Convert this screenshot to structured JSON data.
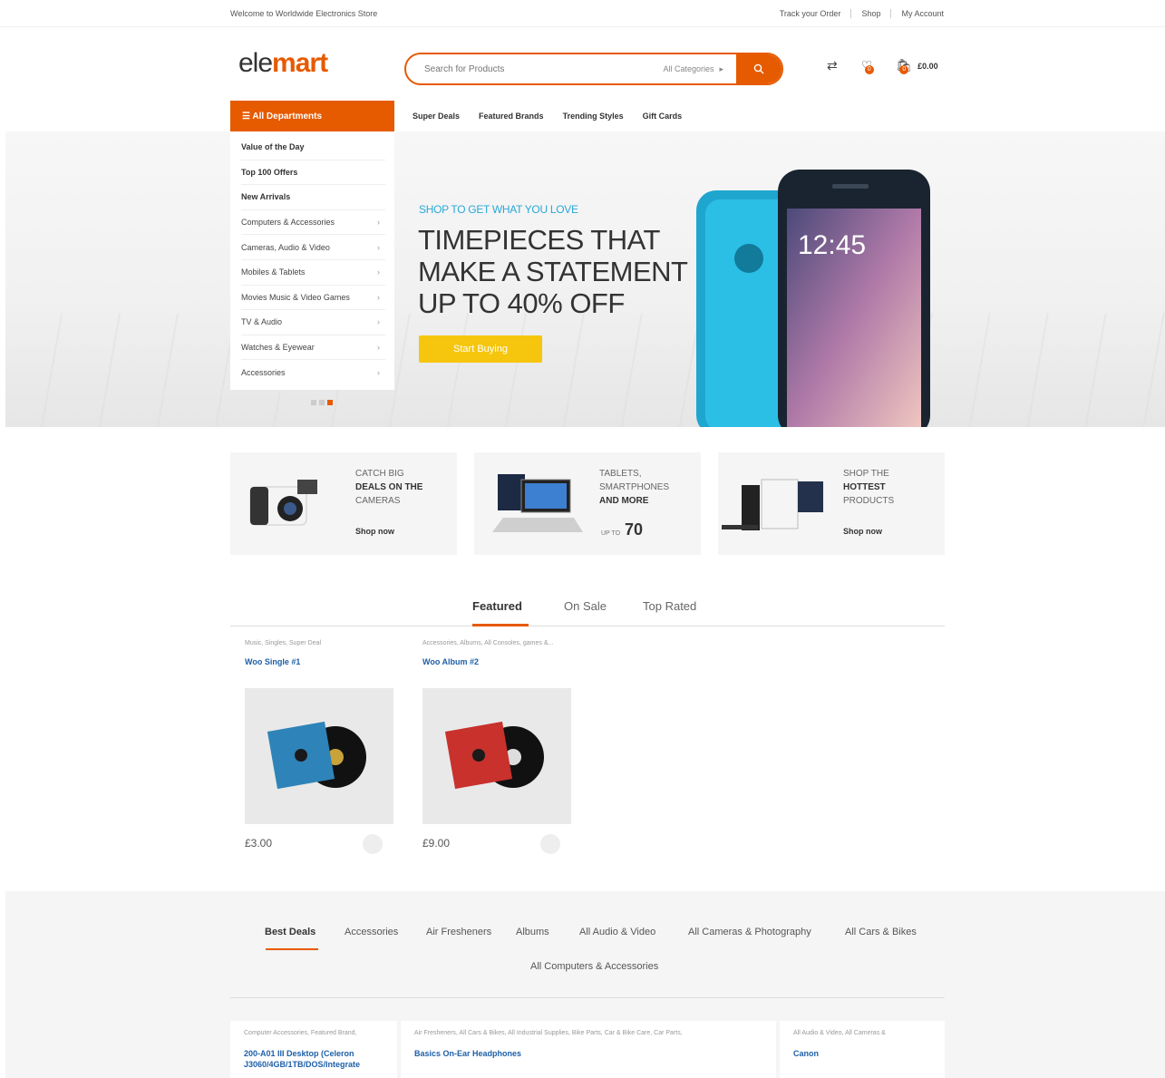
{
  "topbar": {
    "welcome": "Welcome to Worldwide Electronics Store",
    "links": [
      "Track your Order",
      "Shop",
      "My Account"
    ]
  },
  "logo": {
    "part1": "ele",
    "part2": "mart"
  },
  "search": {
    "placeholder": "Search for Products",
    "category": "All Categories"
  },
  "header": {
    "cart_total": "£0.00",
    "wishlist_count": "0",
    "cart_count": "0"
  },
  "departments": {
    "button_label": "All Departments",
    "items": [
      {
        "label": "Value of the Day",
        "bold": true
      },
      {
        "label": "Top 100 Offers",
        "bold": true
      },
      {
        "label": "New Arrivals",
        "bold": true
      },
      {
        "label": "Computers & Accessories",
        "bold": false
      },
      {
        "label": "Cameras, Audio & Video",
        "bold": false
      },
      {
        "label": "Mobiles & Tablets",
        "bold": false
      },
      {
        "label": "Movies Music & Video Games",
        "bold": false
      },
      {
        "label": "TV & Audio",
        "bold": false
      },
      {
        "label": "Watches & Eyewear",
        "bold": false
      },
      {
        "label": "Accessories",
        "bold": false
      }
    ]
  },
  "nav": [
    "Super Deals",
    "Featured Brands",
    "Trending Styles",
    "Gift Cards"
  ],
  "hero": {
    "kicker": "SHOP TO GET WHAT YOU LOVE",
    "title_lines": [
      "TIMEPIECES THAT",
      "MAKE A STATEMENT",
      "UP TO 40% OFF"
    ],
    "button": "Start Buying",
    "phone_time": "12:45"
  },
  "promos": [
    {
      "lines": [
        "CATCH BIG",
        "DEALS ON THE",
        "CAMERAS"
      ],
      "link": "Shop now"
    },
    {
      "lines": [
        "TABLETS,",
        "SMARTPHONES",
        "AND MORE"
      ],
      "upto": "UP TO",
      "value": "70"
    },
    {
      "lines": [
        "SHOP THE",
        "HOTTEST",
        "PRODUCTS"
      ],
      "link": "Shop now"
    }
  ],
  "product_tabs": [
    "Featured",
    "On Sale",
    "Top Rated"
  ],
  "products": [
    {
      "cats": "Music, Singles, Super Deal",
      "name": "Woo Single #1",
      "price": "£3.00",
      "sleeve": "#2e84b8"
    },
    {
      "cats": "Accessories, Albums, All Consoles, games &...",
      "name": "Woo Album #2",
      "price": "£9.00",
      "sleeve": "#c8312c"
    }
  ],
  "deal_tabs": [
    "Best Deals",
    "Accessories",
    "Air Fresheners",
    "Albums",
    "All Audio & Video",
    "All Cameras & Photography",
    "All Cars & Bikes",
    "All Computers & Accessories"
  ],
  "deal_cards": [
    {
      "cats": "Computer Accessories, Featured Brand,",
      "name_lines": [
        "200-A01 III Desktop (Celeron",
        "J3060/4GB/1TB/DOS/Integrate"
      ]
    },
    {
      "cats": "Air Fresheners, All Cars & Bikes, All Industrial Supplies, Bike Parts, Car & Bike Care, Car Parts,",
      "name_lines": [
        "Basics On-Ear Headphones"
      ]
    },
    {
      "cats": "All Audio & Video, All Cameras &",
      "name_lines": [
        "Canon"
      ]
    }
  ],
  "colors": {
    "accent": "#e65a00",
    "link": "#1e5fa8",
    "kicker": "#2aa8d8",
    "cta": "#f6c60e"
  }
}
